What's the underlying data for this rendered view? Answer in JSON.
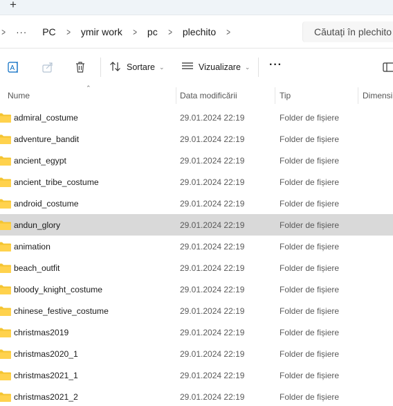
{
  "tabstrip": {
    "new_tab_label": "+"
  },
  "address": {
    "overflow_label": "···",
    "breadcrumbs": [
      "PC",
      "ymir work",
      "pc",
      "plechito"
    ],
    "search_placeholder": "Căutați în plechito"
  },
  "commandbar": {
    "sort_label": "Sortare",
    "view_label": "Vizualizare",
    "more_label": "···"
  },
  "columns": {
    "name": "Nume",
    "date": "Data modificării",
    "type": "Tip",
    "size": "Dimensi"
  },
  "files": [
    {
      "name": "admiral_costume",
      "date": "29.01.2024 22:19",
      "type": "Folder de fișiere"
    },
    {
      "name": "adventure_bandit",
      "date": "29.01.2024 22:19",
      "type": "Folder de fișiere"
    },
    {
      "name": "ancient_egypt",
      "date": "29.01.2024 22:19",
      "type": "Folder de fișiere"
    },
    {
      "name": "ancient_tribe_costume",
      "date": "29.01.2024 22:19",
      "type": "Folder de fișiere"
    },
    {
      "name": "android_costume",
      "date": "29.01.2024 22:19",
      "type": "Folder de fișiere"
    },
    {
      "name": "andun_glory",
      "date": "29.01.2024 22:19",
      "type": "Folder de fișiere",
      "selected": true
    },
    {
      "name": "animation",
      "date": "29.01.2024 22:19",
      "type": "Folder de fișiere"
    },
    {
      "name": "beach_outfit",
      "date": "29.01.2024 22:19",
      "type": "Folder de fișiere"
    },
    {
      "name": "bloody_knight_costume",
      "date": "29.01.2024 22:19",
      "type": "Folder de fișiere"
    },
    {
      "name": "chinese_festive_costume",
      "date": "29.01.2024 22:19",
      "type": "Folder de fișiere"
    },
    {
      "name": "christmas2019",
      "date": "29.01.2024 22:19",
      "type": "Folder de fișiere"
    },
    {
      "name": "christmas2020_1",
      "date": "29.01.2024 22:19",
      "type": "Folder de fișiere"
    },
    {
      "name": "christmas2021_1",
      "date": "29.01.2024 22:19",
      "type": "Folder de fișiere"
    },
    {
      "name": "christmas2021_2",
      "date": "29.01.2024 22:19",
      "type": "Folder de fișiere"
    }
  ],
  "colors": {
    "folder": "#f4c430",
    "selected_row": "#d9d9d9",
    "accent": "#0067c0"
  }
}
